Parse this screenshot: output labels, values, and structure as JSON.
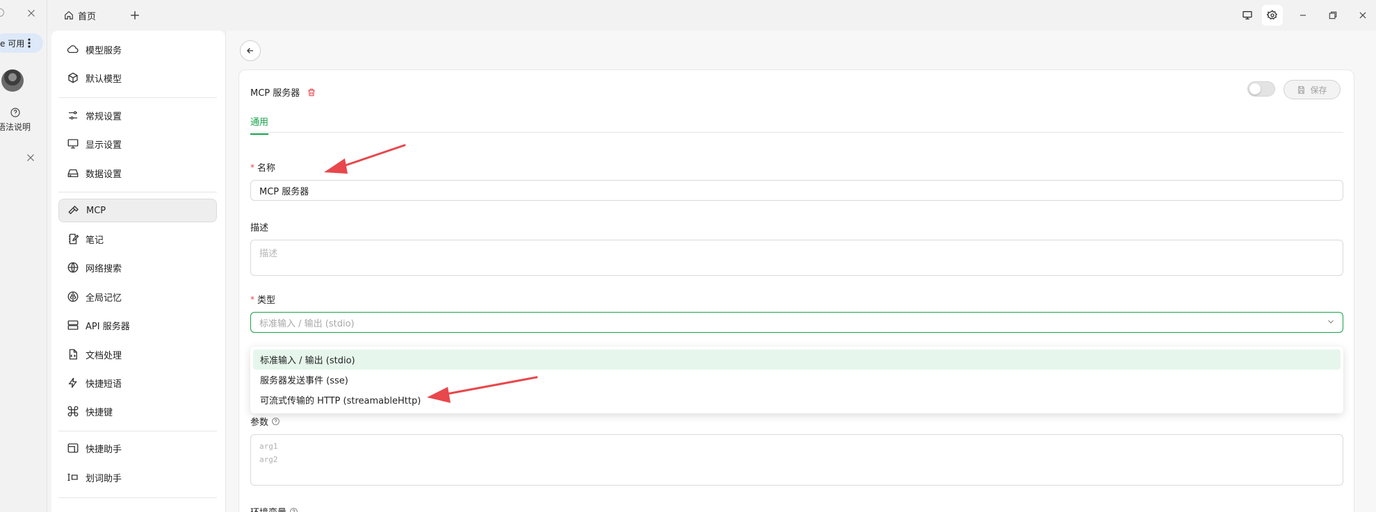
{
  "titlebar": {
    "home_tab_label": "首页",
    "icons": [
      "home-icon",
      "plus-icon",
      "monitor-icon",
      "gear-icon",
      "minimize-icon",
      "restore-icon",
      "close-icon"
    ]
  },
  "left_strip": {
    "status_text": "e 可用",
    "help_label": "语法说明"
  },
  "sidebar": {
    "items": [
      {
        "label": "模型服务",
        "icon": "cloud-icon"
      },
      {
        "label": "默认模型",
        "icon": "cube-icon"
      },
      {
        "label": "常规设置",
        "icon": "sliders-icon"
      },
      {
        "label": "显示设置",
        "icon": "monitor-icon"
      },
      {
        "label": "数据设置",
        "icon": "drive-icon"
      },
      {
        "label": "MCP",
        "icon": "hammer-icon"
      },
      {
        "label": "笔记",
        "icon": "notebook-icon"
      },
      {
        "label": "网络搜索",
        "icon": "globe-icon"
      },
      {
        "label": "全局记忆",
        "icon": "brain-icon"
      },
      {
        "label": "API 服务器",
        "icon": "server-icon"
      },
      {
        "label": "文档处理",
        "icon": "document-icon"
      },
      {
        "label": "快捷短语",
        "icon": "zap-icon"
      },
      {
        "label": "快捷键",
        "icon": "command-icon"
      },
      {
        "label": "快捷助手",
        "icon": "window-icon"
      },
      {
        "label": "划词助手",
        "icon": "text-select-icon"
      }
    ],
    "active_index": 5
  },
  "card": {
    "title": "MCP 服务器",
    "save_label": "保存",
    "tabs": [
      {
        "label": "通用",
        "active": true
      }
    ],
    "fields": {
      "name": {
        "label": "名称",
        "required": true,
        "value": "MCP 服务器"
      },
      "description": {
        "label": "描述",
        "required": false,
        "placeholder": "描述"
      },
      "type": {
        "label": "类型",
        "required": true,
        "value": "标准输入 / 输出 (stdio)"
      },
      "params": {
        "label": "参数",
        "placeholder_lines": [
          "arg1",
          "arg2"
        ]
      },
      "env": {
        "label": "环境变量"
      }
    },
    "type_options": [
      {
        "label": "标准输入 / 输出 (stdio)",
        "selected": true
      },
      {
        "label": "服务器发送事件 (sse)",
        "selected": false
      },
      {
        "label": "可流式传输的 HTTP (streamableHttp)",
        "selected": false
      }
    ]
  },
  "colors": {
    "accent_green": "#16a34a",
    "required_red": "#e5484d",
    "annotation_arrow": "#e8474c",
    "selected_option_bg": "#e6f6ec"
  }
}
